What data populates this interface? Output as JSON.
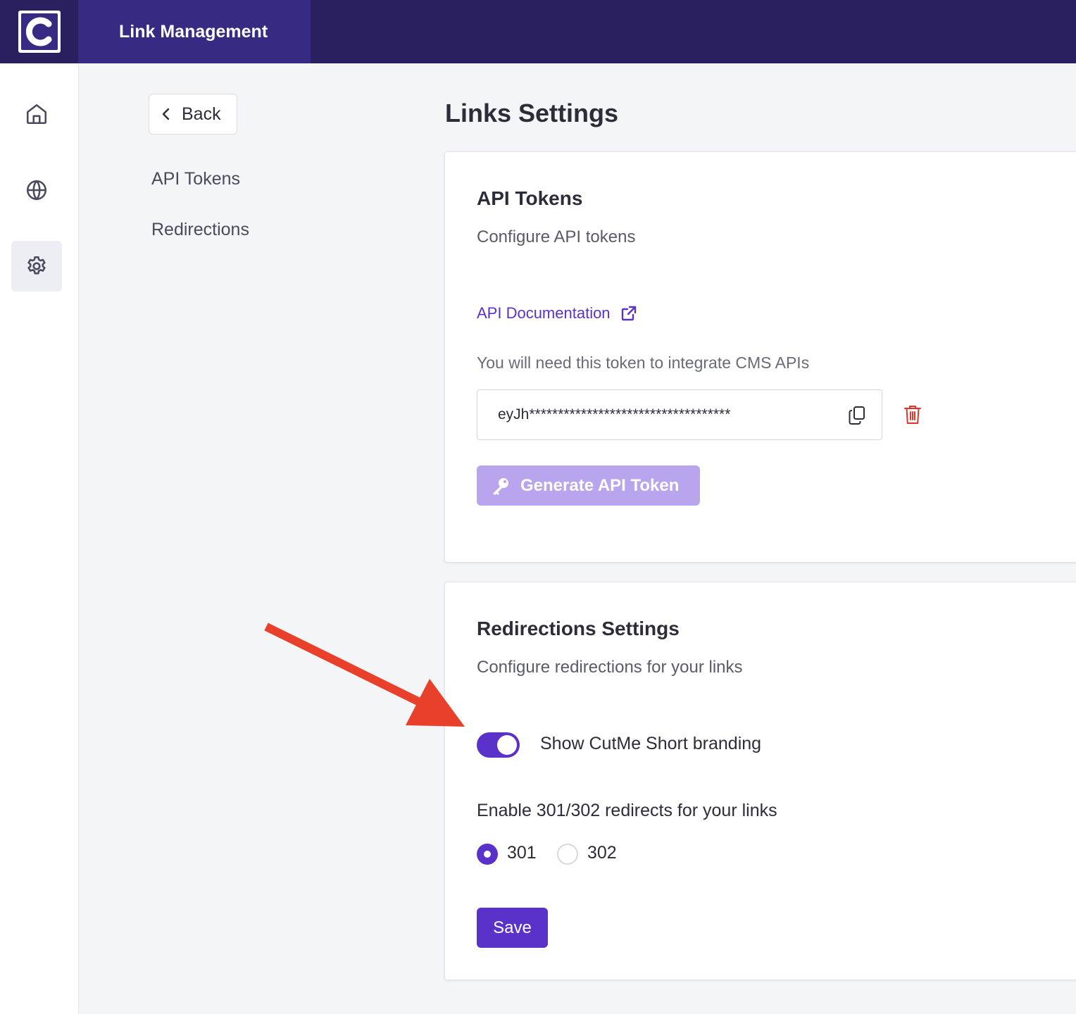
{
  "header": {
    "app_name": "Link Management"
  },
  "leftnav": {
    "items": [
      {
        "icon": "home-icon"
      },
      {
        "icon": "globe-icon"
      },
      {
        "icon": "gear-icon",
        "active": true
      }
    ]
  },
  "subnav": {
    "back_label": "Back",
    "items": [
      "API Tokens",
      "Redirections"
    ]
  },
  "page": {
    "title": "Links Settings"
  },
  "api_card": {
    "title": "API Tokens",
    "subtitle": "Configure API tokens",
    "doc_link": "API Documentation",
    "hint": "You will need this token to integrate CMS APIs",
    "token_value": "eyJh***********************************",
    "generate_label": "Generate API Token"
  },
  "redirect_card": {
    "title": "Redirections Settings",
    "subtitle": "Configure redirections for your links",
    "branding_label": "Show CutMe Short branding",
    "branding_enabled": true,
    "redirect_label": "Enable 301/302 redirects for your links",
    "options": [
      "301",
      "302"
    ],
    "selected": "301",
    "save_label": "Save"
  },
  "colors": {
    "accent": "#5b32c9",
    "topbar": "#2a2060",
    "annotation_arrow": "#e8402a",
    "danger": "#e0352b"
  }
}
